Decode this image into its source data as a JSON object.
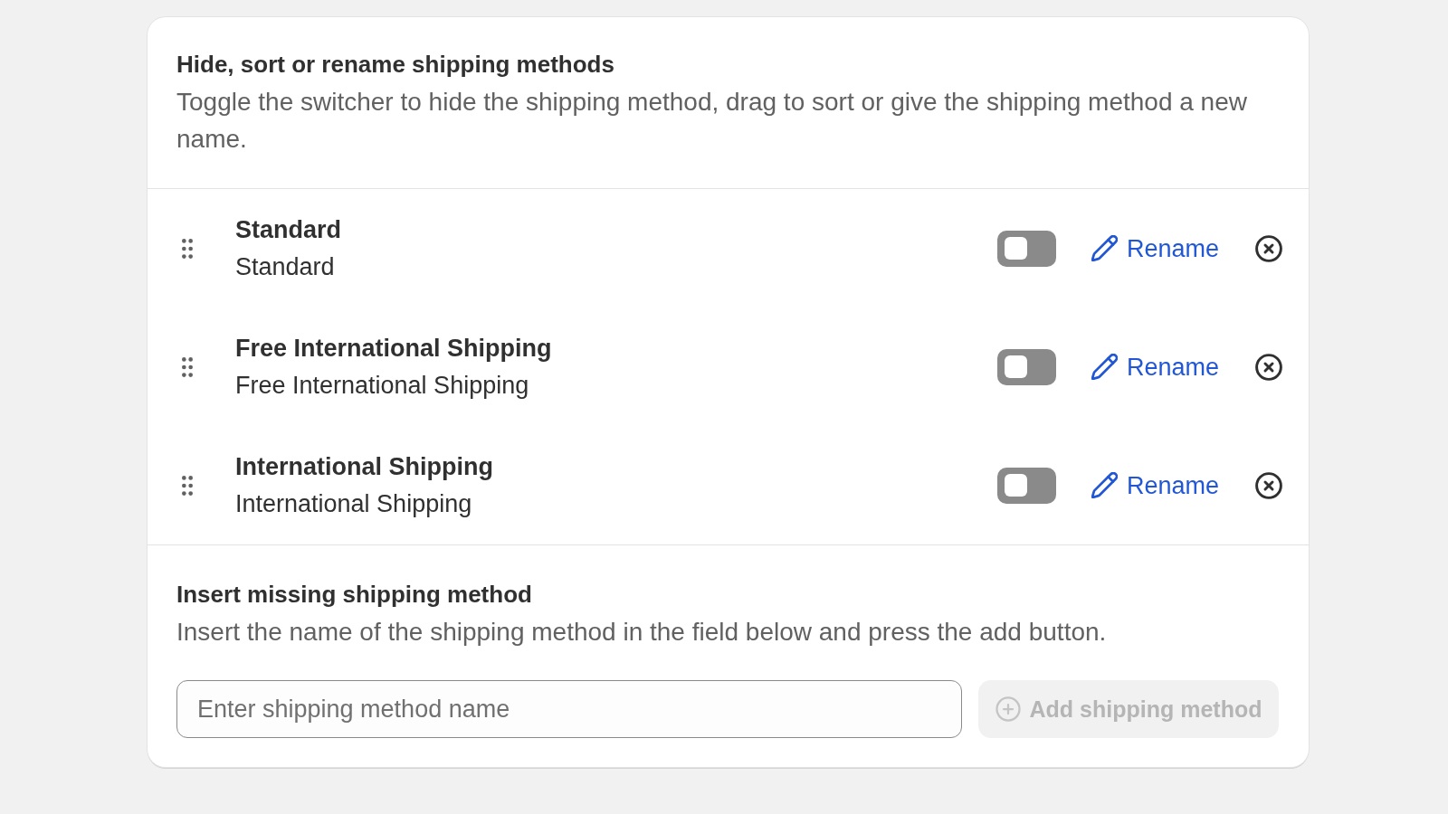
{
  "header": {
    "title": "Hide, sort or rename shipping methods",
    "description": "Toggle the switcher to hide the shipping method, drag to sort or give the shipping method a new name."
  },
  "methods": [
    {
      "name": "Standard",
      "subtitle": "Standard",
      "on": false,
      "rename_label": "Rename"
    },
    {
      "name": "Free International Shipping",
      "subtitle": "Free International Shipping",
      "on": false,
      "rename_label": "Rename"
    },
    {
      "name": "International Shipping",
      "subtitle": "International Shipping",
      "on": false,
      "rename_label": "Rename"
    }
  ],
  "insert": {
    "title": "Insert missing shipping method",
    "description": "Insert the name of the shipping method in the field below and press the add button.",
    "input": {
      "placeholder": "Enter shipping method name"
    },
    "add_button": {
      "label": "Add shipping method",
      "disabled": true
    }
  }
}
